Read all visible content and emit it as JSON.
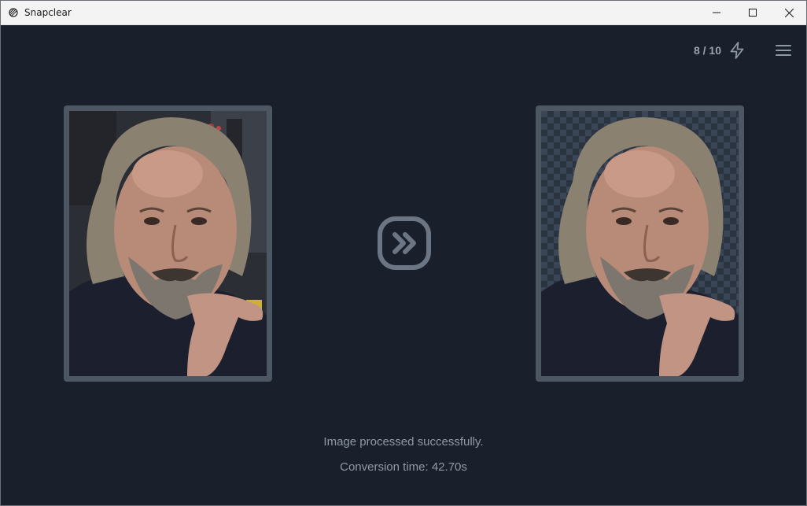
{
  "window": {
    "title": "Snapclear",
    "app_icon": "snapclear-logo-icon",
    "controls": [
      "minimize-icon",
      "maximize-icon",
      "close-icon"
    ]
  },
  "header": {
    "counter": "8 / 10",
    "bolt_icon": "lightning-bolt-icon",
    "menu_icon": "hamburger-menu-icon"
  },
  "images": {
    "original_alt": "Original photo of a man with grey hair and beard resting finger on chin",
    "result_alt": "Background-removed photo of the same man on a transparent checkerboard"
  },
  "convert_icon": "double-chevron-right-icon",
  "status": {
    "message": "Image processed successfully.",
    "conversion_time": "Conversion time: 42.70s"
  },
  "colors": {
    "background": "#1a202b",
    "frame": "#4d5663",
    "text_muted": "#8f98a5",
    "icon": "#6b7583"
  }
}
